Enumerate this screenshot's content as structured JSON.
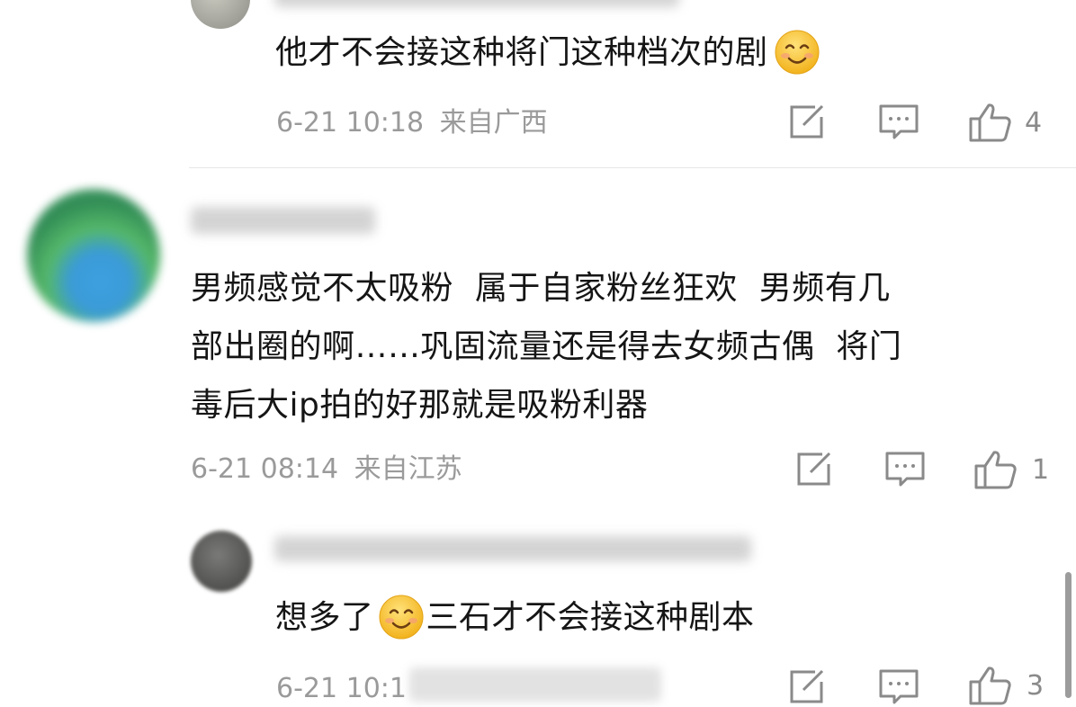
{
  "comments": [
    {
      "text_main": "他才不会接这种将门这种档次的剧",
      "timestamp": "6-21 10:18",
      "location": "来自广西",
      "like_count": "4"
    },
    {
      "text_lines": [
        "男频感觉不太吸粉  属于自家粉丝狂欢  男频有几",
        "部出圈的啊……巩固流量还是得去女频古偶  将门",
        "毒后大ip拍的好那就是吸粉利器"
      ],
      "timestamp": "6-21 08:14",
      "location": "来自江苏",
      "like_count": "1"
    },
    {
      "text_before_emoji": "想多了",
      "text_after_emoji": "三石才不会接这种剧本",
      "timestamp": "6-21 10:1",
      "like_count": "3"
    }
  ],
  "icons": {
    "edit": "edit-icon",
    "comment": "comment-icon",
    "like": "thumbs-up-icon",
    "emoji": "smiling-face-emoji"
  },
  "colors": {
    "meta_gray": "#9a9a9a",
    "text": "#151515",
    "emoji_yellow": "#f7c948"
  }
}
